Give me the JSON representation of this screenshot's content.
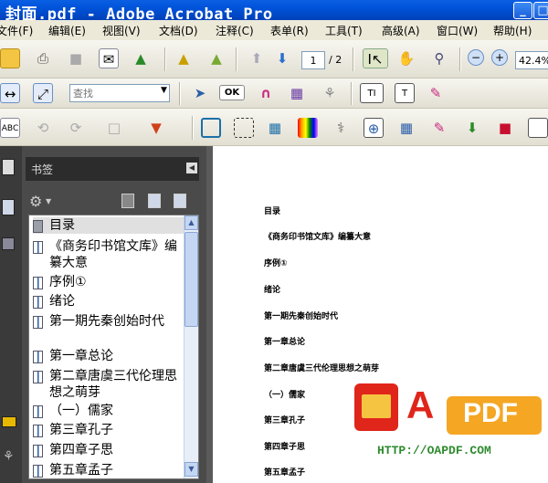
{
  "window": {
    "title": "封面.pdf - Adobe Acrobat Pro",
    "controls": [
      "_",
      "□"
    ]
  },
  "menu": [
    "文件(F)",
    "编辑(E)",
    "视图(V)",
    "文档(D)",
    "注释(C)",
    "表单(R)",
    "工具(T)",
    "高级(A)",
    "窗口(W)",
    "帮助(H)"
  ],
  "toolbar": {
    "page_current": "1",
    "page_total": "/ 2",
    "zoom": "42.4%",
    "find_placeholder": "查找",
    "ok_label": "OK"
  },
  "bookmarks_panel": {
    "title": "书签",
    "items": [
      "目录",
      "《商务印书馆文库》编纂大意",
      "序例①",
      "绪论",
      "第一期先秦创始时代",
      "第一章总论",
      "第二章唐虞三代伦理思想之萌芽",
      "（一）儒家",
      "第三章孔子",
      "第四章子思",
      "第五章孟子"
    ]
  },
  "document": {
    "lines": [
      "目录",
      "《商务印书馆文库》编纂大意",
      "序例①",
      "绪论",
      "第一期先秦创始时代",
      "第一章总论",
      "第二章唐虞三代伦理思想之萌芽",
      "（一）儒家",
      "第三章孔子",
      "第四章子思",
      "第五章孟子"
    ]
  },
  "watermark": {
    "letter": "A",
    "brand": "PDF",
    "url": "HTTP://OAPDF.COM"
  },
  "colors": {
    "titlebar": "#0053d9",
    "panel_dark": "#4a4a4a",
    "watermark_red": "#e0251b",
    "watermark_orange": "#f5a623",
    "watermark_green": "#2e8b2e"
  }
}
